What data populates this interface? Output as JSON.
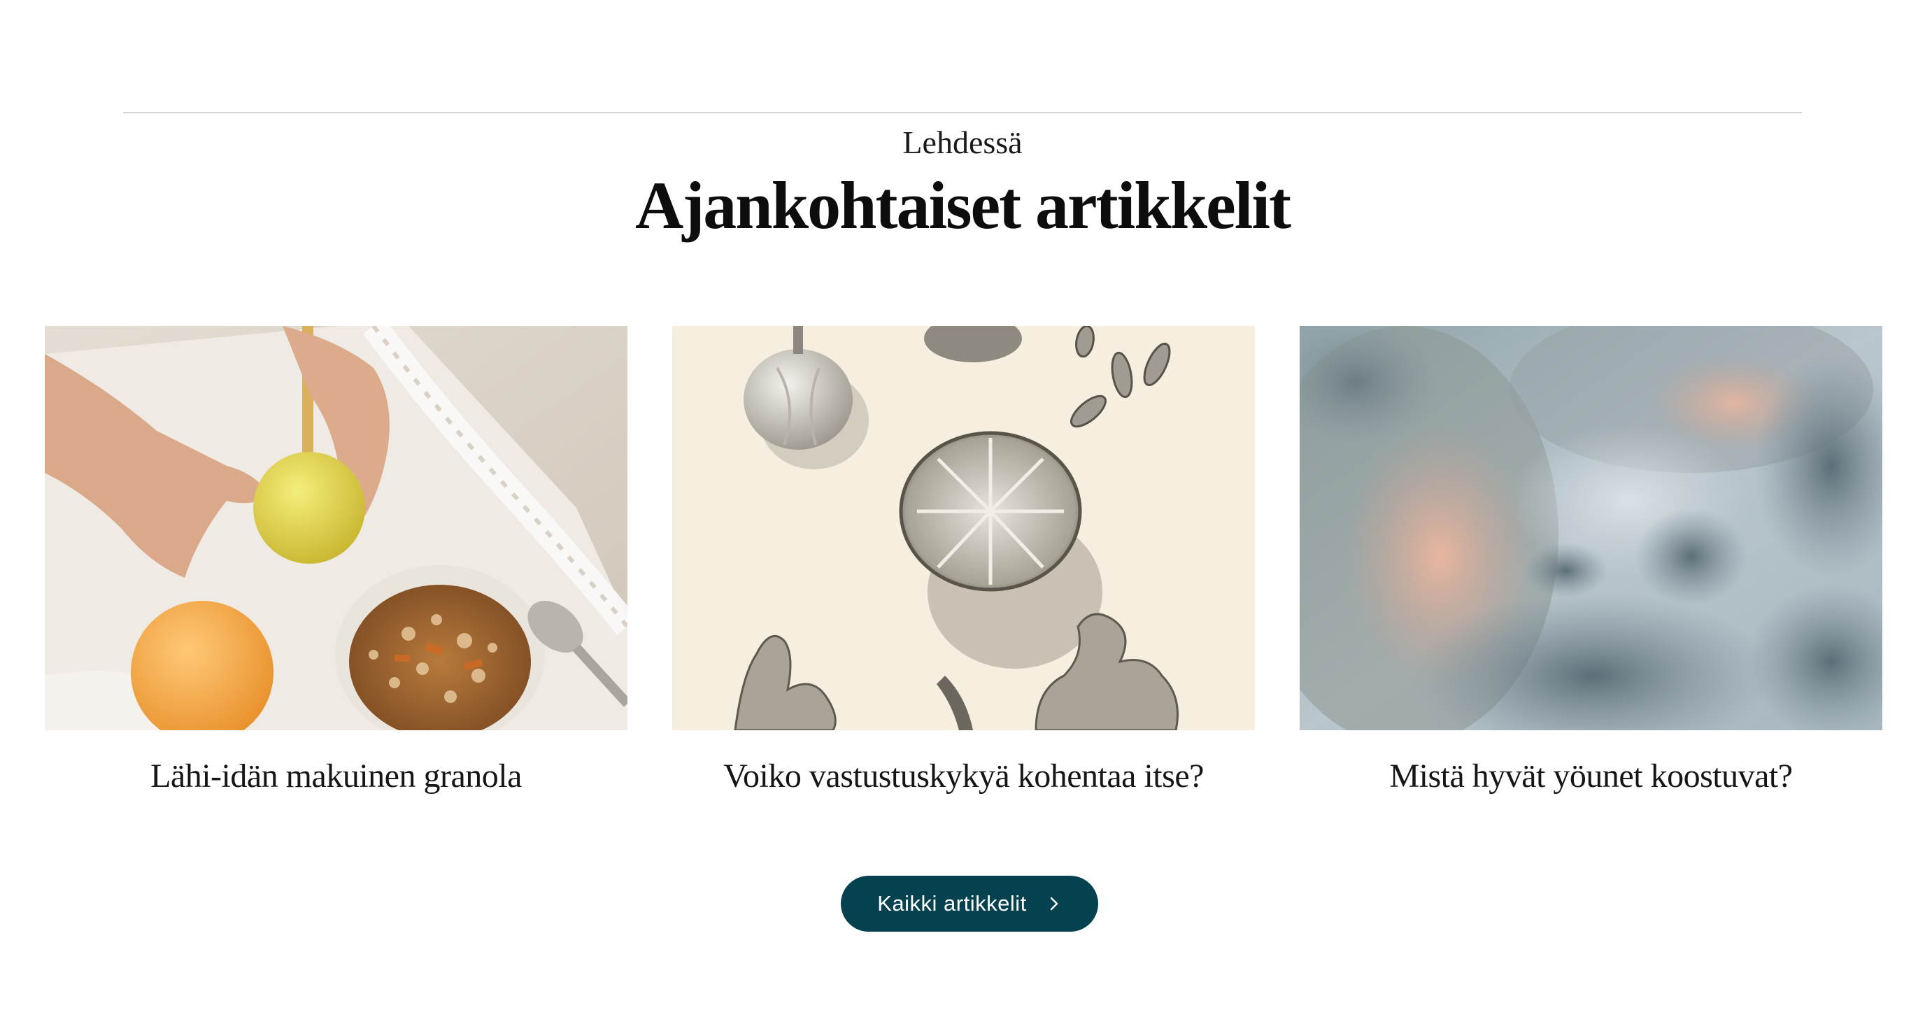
{
  "section": {
    "eyebrow": "Lehdessä",
    "title": "Ajankohtaiset artikkelit"
  },
  "articles": [
    {
      "title": "Lähi-idän makuinen granola"
    },
    {
      "title": "Voiko vastustuskykyä kohentaa itse?"
    },
    {
      "title": "Mistä hyvät yöunet koostuvat?"
    }
  ],
  "cta": {
    "label": "Kaikki artikkelit",
    "icon": "chevron-right-icon"
  },
  "colors": {
    "button_bg": "#06414f",
    "button_text": "#ffffff",
    "divider": "#d2d2d2"
  }
}
